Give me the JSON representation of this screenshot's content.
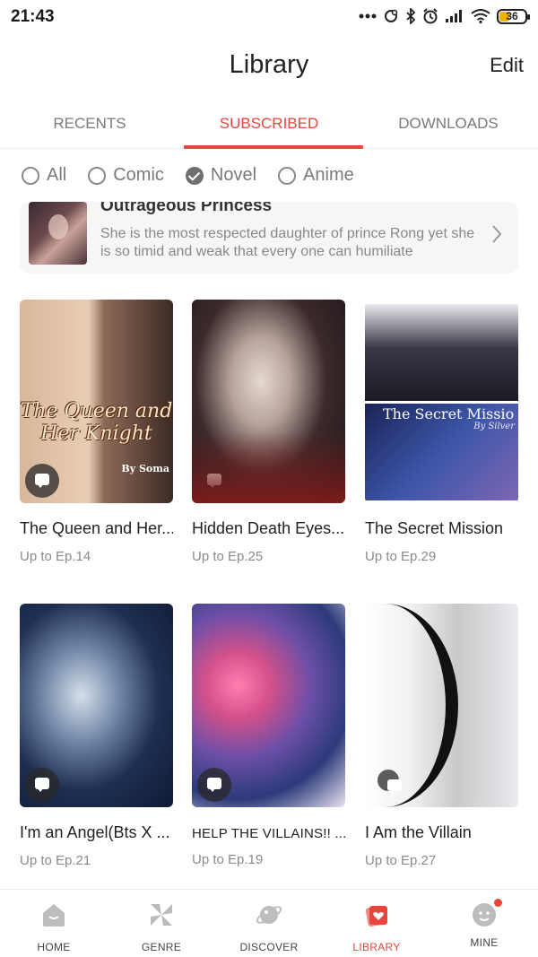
{
  "status": {
    "time": "21:43",
    "battery": "36",
    "battery_level_percent": 36
  },
  "header": {
    "title": "Library",
    "edit_label": "Edit"
  },
  "tabs": [
    {
      "label": "RECENTS",
      "active": false
    },
    {
      "label": "SUBSCRIBED",
      "active": true
    },
    {
      "label": "DOWNLOADS",
      "active": false
    }
  ],
  "filters": [
    {
      "label": "All",
      "checked": false
    },
    {
      "label": "Comic",
      "checked": false
    },
    {
      "label": "Novel",
      "checked": true
    },
    {
      "label": "Anime",
      "checked": false
    }
  ],
  "featured": {
    "title": "Outrageous Princess",
    "description": "She is the most respected daughter of prince Rong yet she is so timid and weak that every one can humiliate"
  },
  "books": [
    {
      "title": "The Queen and Her...",
      "progress": "Up to Ep.14",
      "cover_text": "The Queen and Her Knight",
      "cover_author": "By Soma"
    },
    {
      "title": "Hidden Death Eyes...",
      "progress": "Up to Ep.25"
    },
    {
      "title": "The Secret Mission",
      "progress": "Up to Ep.29",
      "cover_text": "The Secret Missio",
      "cover_author": "By Silver"
    },
    {
      "title": "I'm an Angel(Bts X ...",
      "progress": "Up to Ep.21"
    },
    {
      "title": "HELP THE VILLAINS!! ...",
      "progress": "Up to Ep.19"
    },
    {
      "title": "I Am the Villain",
      "progress": "Up to Ep.27"
    }
  ],
  "nav": [
    {
      "label": "HOME",
      "icon": "home-icon"
    },
    {
      "label": "GENRE",
      "icon": "genre-icon"
    },
    {
      "label": "DISCOVER",
      "icon": "planet-icon"
    },
    {
      "label": "LIBRARY",
      "icon": "library-icon",
      "active": true
    },
    {
      "label": "MINE",
      "icon": "profile-icon"
    }
  ],
  "colors": {
    "accent": "#e8453c",
    "muted": "#7a7a7a"
  }
}
